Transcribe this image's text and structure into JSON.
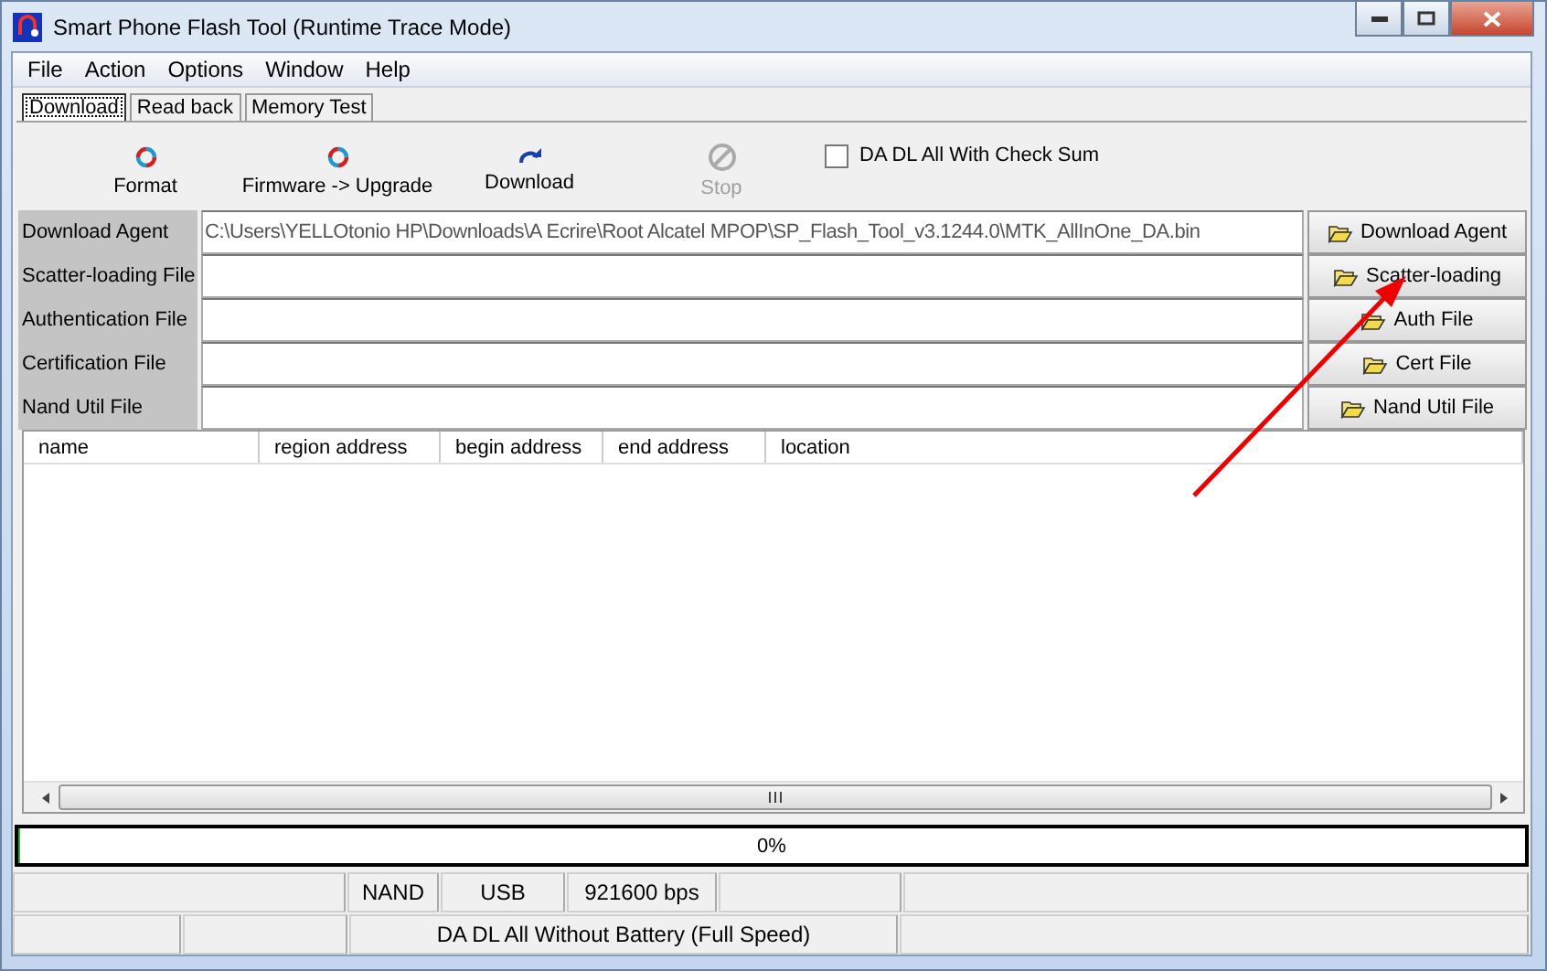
{
  "window": {
    "title": "Smart Phone Flash Tool (Runtime Trace Mode)"
  },
  "menu": [
    "File",
    "Action",
    "Options",
    "Window",
    "Help"
  ],
  "tabs": [
    {
      "label": "Download",
      "selected": true
    },
    {
      "label": "Read back",
      "selected": false
    },
    {
      "label": "Memory Test",
      "selected": false
    }
  ],
  "toolbar": [
    {
      "label": "Format",
      "kind": "cycle",
      "disabled": false
    },
    {
      "label": "Firmware -> Upgrade",
      "kind": "cycle",
      "disabled": false
    },
    {
      "label": "Download",
      "kind": "download",
      "disabled": false
    },
    {
      "label": "Stop",
      "kind": "stop",
      "disabled": true
    }
  ],
  "checksum": {
    "label": "DA DL All With Check Sum",
    "checked": false
  },
  "files": [
    {
      "label": "Download Agent",
      "value": "C:\\Users\\YELLOtonio HP\\Downloads\\A Ecrire\\Root Alcatel MPOP\\SP_Flash_Tool_v3.1244.0\\MTK_AllInOne_DA.bin",
      "button": "Download Agent"
    },
    {
      "label": "Scatter-loading File",
      "button": "Scatter-loading"
    },
    {
      "label": "Authentication File",
      "button": "Auth File"
    },
    {
      "label": "Certification File",
      "button": "Cert File"
    },
    {
      "label": "Nand Util File",
      "button": "Nand Util File"
    }
  ],
  "table": {
    "columns": [
      "name",
      "region address",
      "begin address",
      "end address",
      "location"
    ]
  },
  "progress": {
    "text": "0%",
    "level": 0
  },
  "status_bar": {
    "row_1": [
      "NAND",
      "USB",
      "921600 bps"
    ],
    "row_2": [
      "DA DL All Without Battery (Full Speed)"
    ]
  }
}
